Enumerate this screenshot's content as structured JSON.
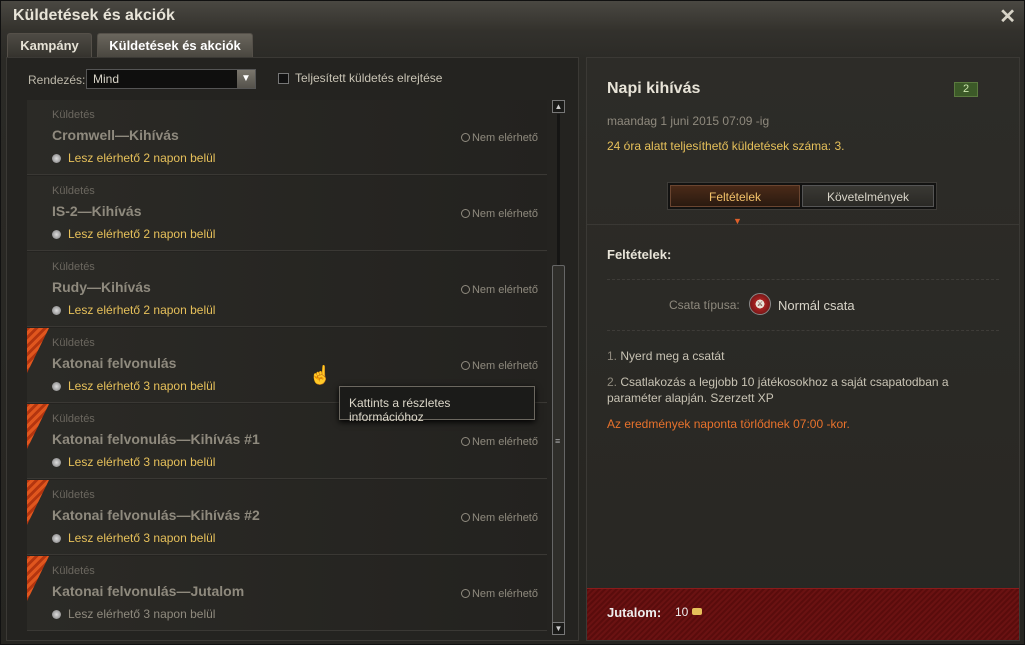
{
  "window": {
    "title": "Küldetések és akciók",
    "close": "✕"
  },
  "tabs": [
    {
      "label": "Kampány"
    },
    {
      "label": "Küldetések és akciók"
    }
  ],
  "filter": {
    "sort_label": "Rendezés:",
    "sort_value": "Mind",
    "hide_completed_label": "Teljesített küldetés elrejtése"
  },
  "missions": [
    {
      "type": "Küldetés",
      "name": "Cromwell—Kihívás",
      "availability": "Lesz elérhető 2 napon belül",
      "status": "Nem elérhető"
    },
    {
      "type": "Küldetés",
      "name": "IS-2—Kihívás",
      "availability": "Lesz elérhető 2 napon belül",
      "status": "Nem elérhető"
    },
    {
      "type": "Küldetés",
      "name": "Rudy—Kihívás",
      "availability": "Lesz elérhető 2 napon belül",
      "status": "Nem elérhető"
    },
    {
      "type": "Küldetés",
      "name": "Katonai felvonulás",
      "availability": "Lesz elérhető 3 napon belül",
      "status": "Nem elérhető"
    },
    {
      "type": "Küldetés",
      "name": "Katonai felvonulás—Kihívás #1",
      "availability": "Lesz elérhető 3 napon belül",
      "status": "Nem elérhető"
    },
    {
      "type": "Küldetés",
      "name": "Katonai felvonulás—Kihívás #2",
      "availability": "Lesz elérhető 3 napon belül",
      "status": "Nem elérhető"
    },
    {
      "type": "Küldetés",
      "name": "Katonai felvonulás—Jutalom",
      "availability": "Lesz elérhető 3 napon belül",
      "status": "Nem elérhető"
    }
  ],
  "tooltip": "Kattints a részletes információhoz",
  "detail": {
    "title": "Napi kihívás",
    "badge": "2",
    "date": "maandag 1 juni 2015 07:09 -ig",
    "count": "24 óra alatt teljesíthető küldetések száma: 3.",
    "tabs": [
      "Feltételek",
      "Követelmények"
    ],
    "section_title": "Feltételek:",
    "battle_type_label": "Csata típusa:",
    "battle_type_value": "Normál csata",
    "conditions": [
      {
        "num": "1.",
        "text": "Nyerd meg a csatát"
      },
      {
        "num": "2.",
        "text": "Csatlakozás a legjobb 10 játékosokhoz a saját csapatodban a paraméter alapján. Szerzett XP"
      }
    ],
    "reset_note": "Az eredmények naponta törlődnek 07:00 -kor.",
    "reward_label": "Jutalom:",
    "reward_value": "10"
  }
}
